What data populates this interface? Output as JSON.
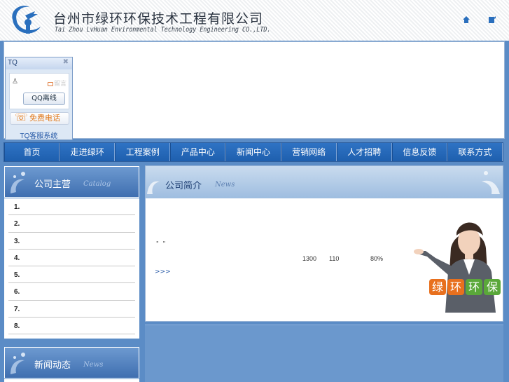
{
  "header": {
    "company_cn": "台州市绿环环保技术工程有限公司",
    "company_en": "Tai Zhou LvHuan Environmental Technology Engineering CO.,LTD.",
    "icons": [
      "home-icon",
      "bookmark-icon"
    ],
    "brand_color": "#1f6ab8"
  },
  "tq": {
    "title": "TQ",
    "close": "✖",
    "message_label": "留言",
    "qq_button": "QQ离线",
    "call_button": "免费电话",
    "footer": "TQ客服系统"
  },
  "nav": {
    "items": [
      "首页",
      "走进绿环",
      "工程案例",
      "产品中心",
      "新闻中心",
      "营销网络",
      "人才招聘",
      "信息反馈",
      "联系方式"
    ]
  },
  "sidebar": {
    "catalog": {
      "title_cn": "公司主营",
      "title_en": "Catalog",
      "items": [
        "1.",
        "2.",
        "3.",
        "4.",
        "5.",
        "6.",
        "7.",
        "8."
      ]
    },
    "news": {
      "title_cn": "新闻动态",
      "title_en": "News"
    }
  },
  "main": {
    "title_cn": "公司简介",
    "title_en": "News",
    "quote_marks": "\"\"",
    "stats": [
      "1300",
      "110",
      "80%"
    ],
    "more_link": ">>>",
    "slogan": [
      "绿",
      "环",
      "环",
      "保"
    ],
    "slogan_colors": [
      "#e8701e",
      "#e8701e",
      "#5aa83a",
      "#5aa83a"
    ]
  }
}
